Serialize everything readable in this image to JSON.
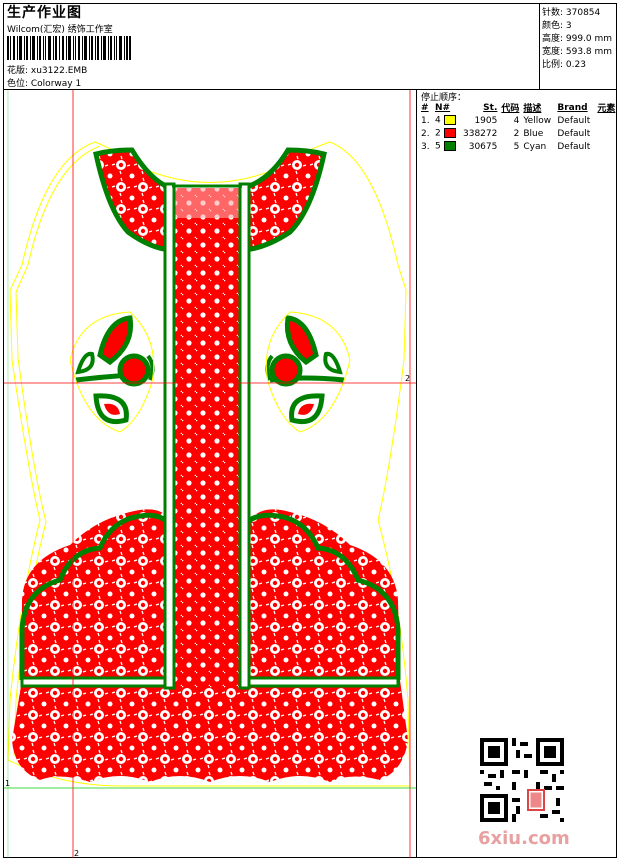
{
  "header": {
    "title": "生产作业图",
    "company": "Wilcom(汇宏) 绣饰工作室",
    "design_label": "花版: xu3122.EMB",
    "colorway_label": "色位:  Colorway 1"
  },
  "stats": {
    "stitches": "针数: 370854",
    "colors": "颜色: 3",
    "height": "高度: 999.0 mm",
    "width": "宽度: 593.8 mm",
    "scale": "比例: 0.23"
  },
  "stop_sequence": {
    "title": "停止顺序：",
    "columns": [
      "#",
      "N#",
      "St.",
      "代码",
      "描述",
      "Brand",
      "元素"
    ],
    "rows": [
      {
        "index": "1.",
        "needle": "4",
        "color": "#ffff00",
        "stitches": "1905",
        "code": "4",
        "desc": "Yellow",
        "brand": "Default"
      },
      {
        "index": "2.",
        "needle": "2",
        "color": "#ff0000",
        "stitches": "338272",
        "code": "2",
        "desc": "Blue",
        "brand": "Default"
      },
      {
        "index": "3.",
        "needle": "5",
        "color": "#008000",
        "stitches": "30675",
        "code": "5",
        "desc": "Cyan",
        "brand": "Default"
      }
    ]
  },
  "canvas": {
    "axis_label_right": "2",
    "axis_label_bottom": "2",
    "axis_label_left": "1"
  },
  "colors": {
    "red": "#ff0000",
    "green": "#008000",
    "yellow": "#ffff00",
    "guide_red": "#ff0000",
    "guide_green": "#00cc00"
  },
  "watermark": {
    "logo_text": "6xiu.com"
  }
}
